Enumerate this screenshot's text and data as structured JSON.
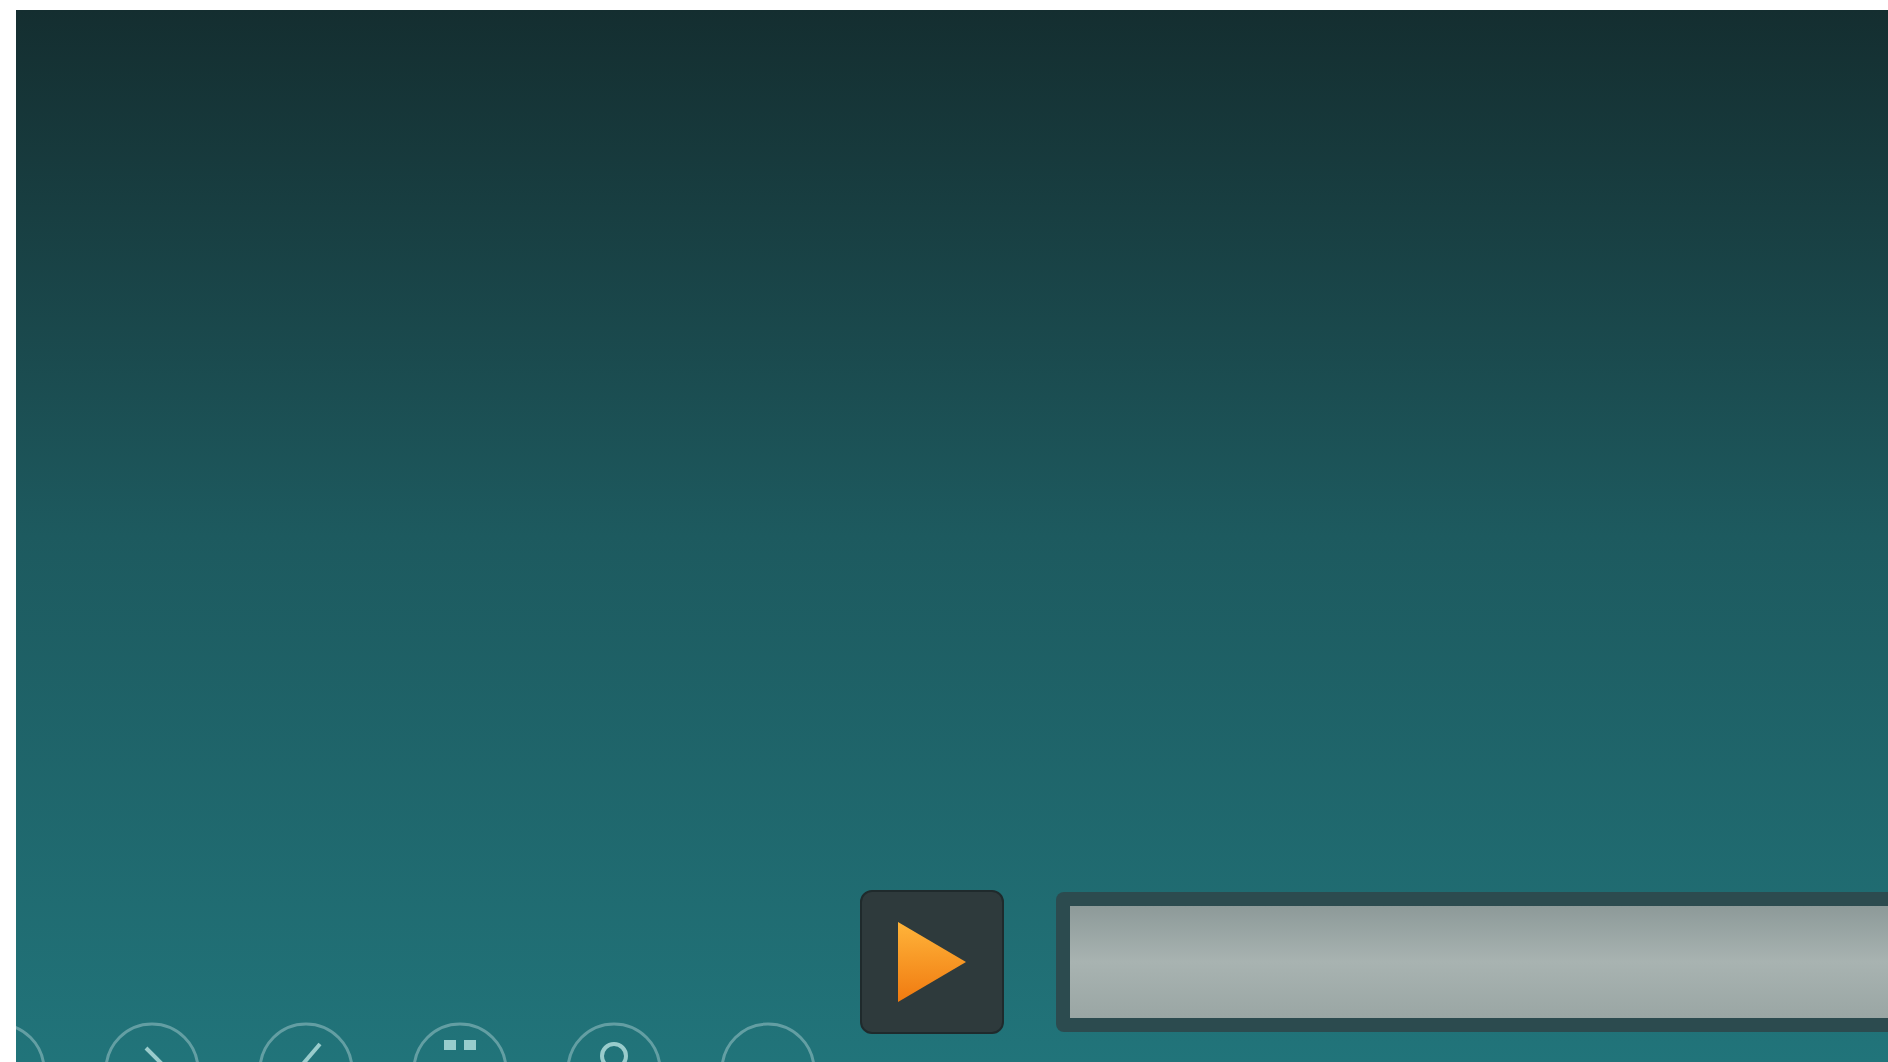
{
  "media_player": {
    "playing": false
  }
}
